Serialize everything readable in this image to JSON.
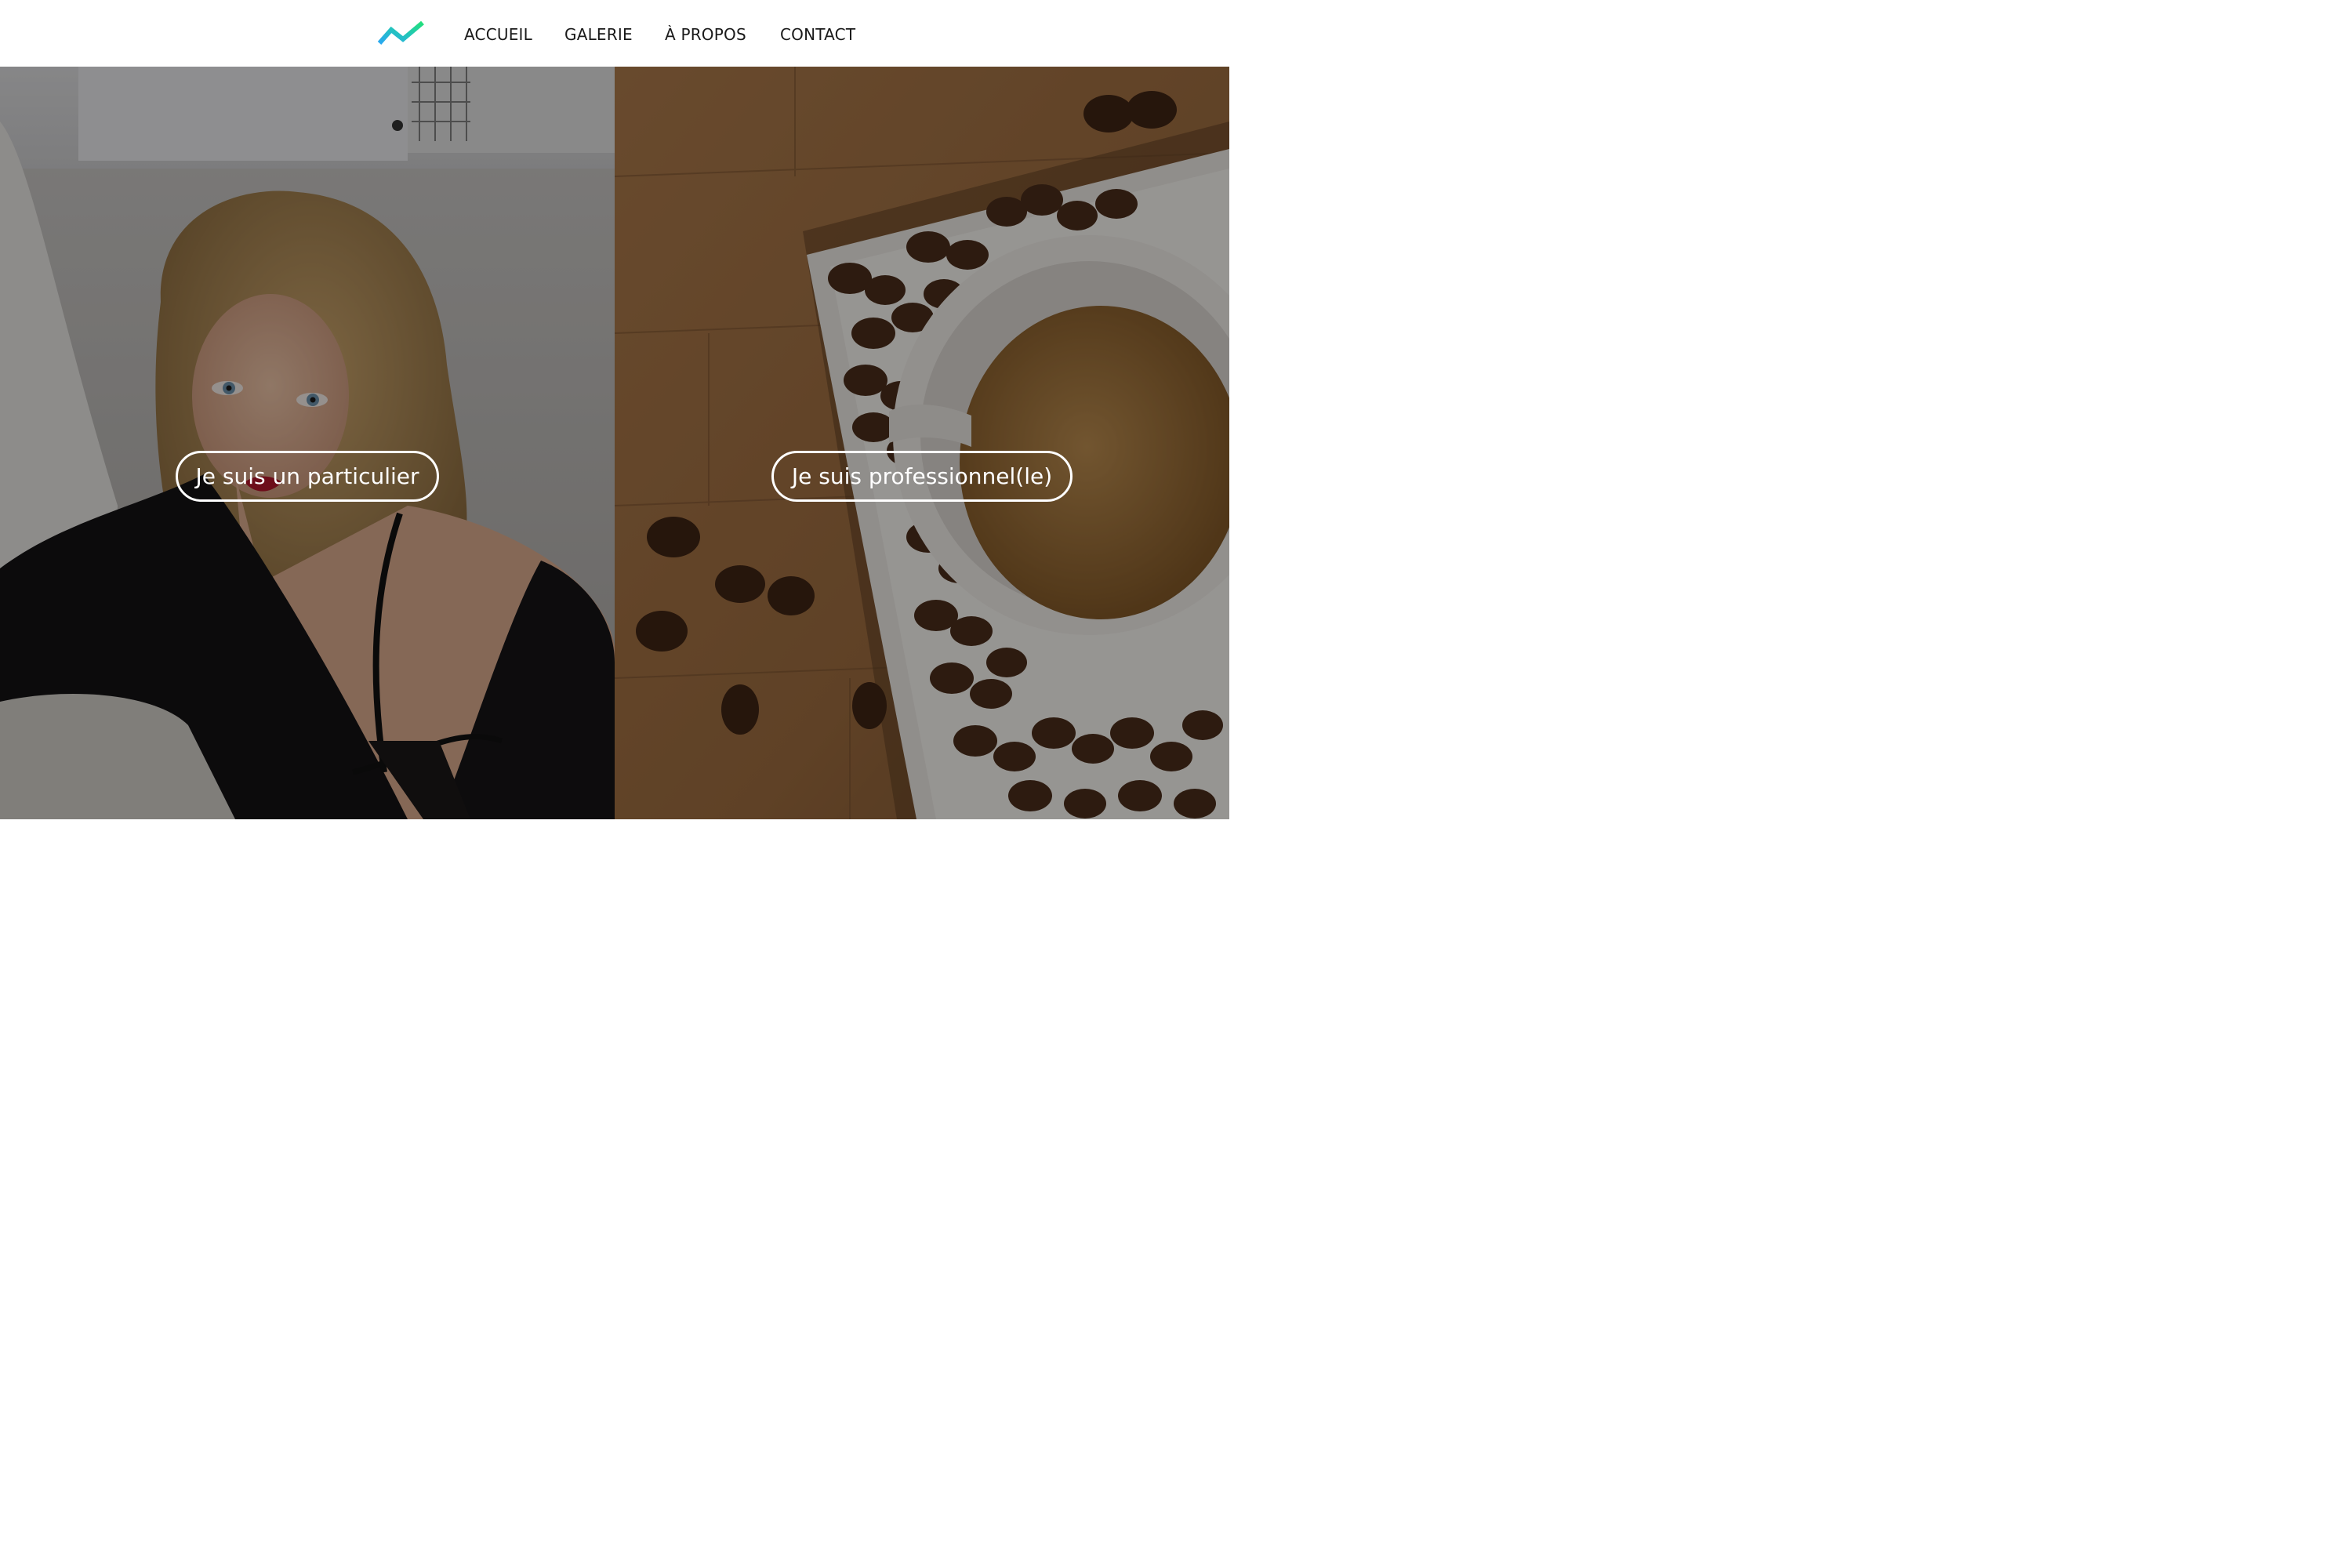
{
  "nav": {
    "logo_icon": "zigzag-logo-icon",
    "items": [
      {
        "label": "ACCUEIL"
      },
      {
        "label": "GALERIE"
      },
      {
        "label": "À PROPOS"
      },
      {
        "label": "CONTACT"
      }
    ]
  },
  "panels": {
    "left": {
      "image": "portrait-woman-photo",
      "cta_label": "Je suis un particulier"
    },
    "right": {
      "image": "coffee-beans-cup-photo",
      "cta_label": "Je suis professionnel(le)"
    }
  },
  "colors": {
    "logo_blue": "#2aa8f2",
    "logo_green": "#22e07a",
    "nav_text": "#1a1a1a",
    "cta_border": "#ffffff"
  }
}
